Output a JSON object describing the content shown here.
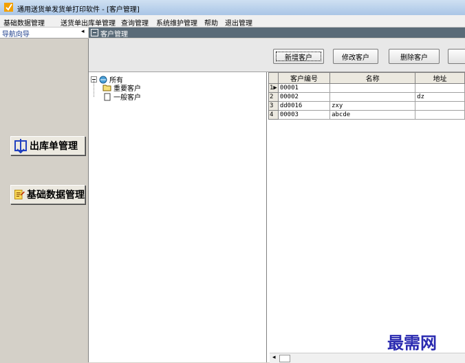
{
  "window": {
    "title": "通用送货单发货单打印软件  - [客户管理]"
  },
  "menu": {
    "items": [
      "基础数据管理",
      "送货单出库单管理",
      "查询管理",
      "系统维护管理",
      "帮助",
      "退出管理"
    ]
  },
  "nav": {
    "title": "导航向导",
    "pin": "◂",
    "buttons": [
      "出库单管理",
      "基础数据管理"
    ]
  },
  "content": {
    "title": "客户管理"
  },
  "toolbar": {
    "buttons": [
      "新增客户",
      "修改客户",
      "删除客户"
    ]
  },
  "tree": {
    "root": "所有",
    "children": [
      "重要客户",
      "一般客户"
    ]
  },
  "grid": {
    "columns": [
      "客户编号",
      "名称",
      "地址"
    ],
    "rows": [
      {
        "no": "1",
        "code": "00001",
        "name": "",
        "addr": ""
      },
      {
        "no": "2",
        "code": "00002",
        "name": "",
        "addr": "dz"
      },
      {
        "no": "3",
        "code": "dd0016",
        "name": "zxy",
        "addr": ""
      },
      {
        "no": "4",
        "code": "00003",
        "name": "abcde",
        "addr": ""
      }
    ]
  },
  "watermark": "最需网",
  "colors": {
    "content_header": "#5a6b78",
    "nav_title": "#1a3b8a",
    "watermark": "#2a2ab0"
  }
}
